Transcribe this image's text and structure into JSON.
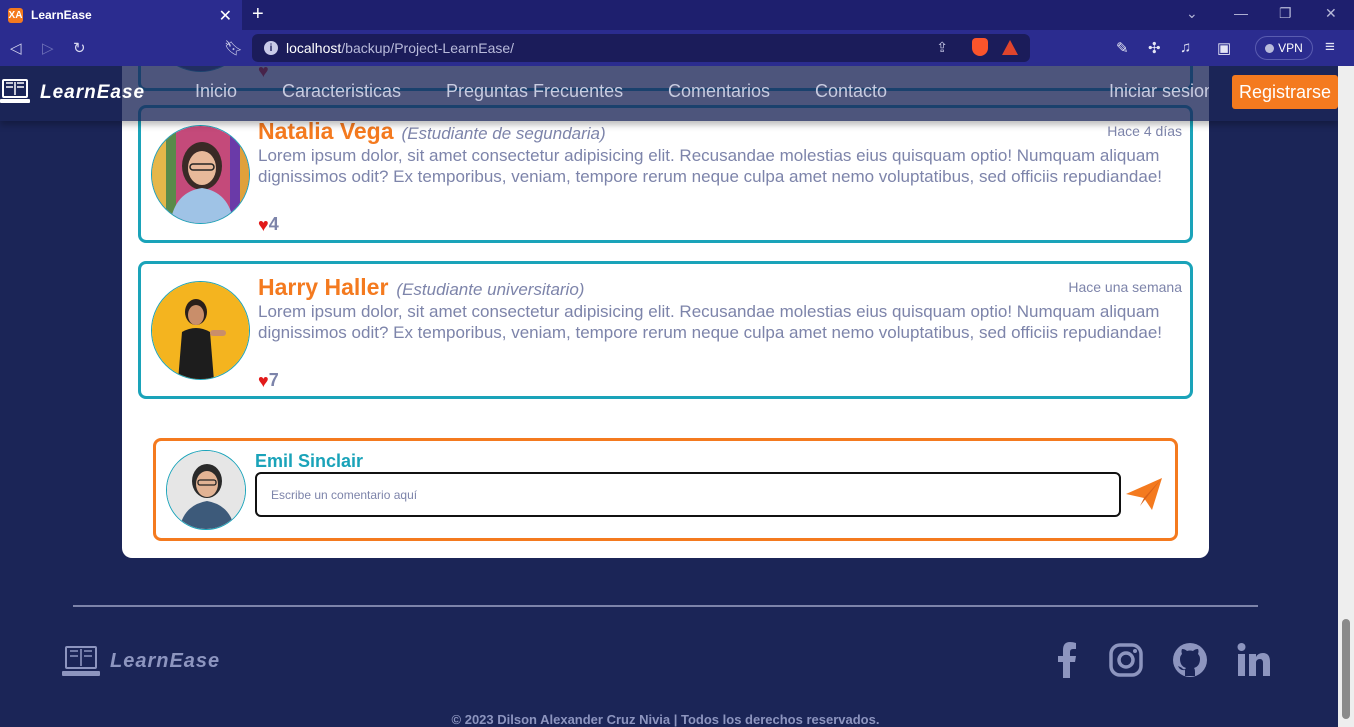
{
  "browser": {
    "tab_title": "LearnEase",
    "tab_favicon": "XA",
    "url_host": "localhost",
    "url_path": "/backup/Project-LearnEase/",
    "vpn_label": "VPN"
  },
  "navbar": {
    "logo": "LearnEase",
    "links": [
      "Inicio",
      "Caracteristicas",
      "Preguntas Frecuentes",
      "Comentarios",
      "Contacto"
    ],
    "login": "Iniciar sesion",
    "register": "Registrarse"
  },
  "comments": [
    {
      "name": "Natalia Vega",
      "role": "(Estudiante de segundaria)",
      "time": "Hace 4 días",
      "text": "Lorem ipsum dolor, sit amet consectetur adipisicing elit. Recusandae molestias eius quisquam optio! Numquam aliquam dignissimos odit? Ex temporibus, veniam, tempore rerum neque culpa amet nemo voluptatibus, sed officiis repudiandae!",
      "likes": "4"
    },
    {
      "name": "Harry Haller",
      "role": "(Estudiante universitario)",
      "time": "Hace una semana",
      "text": "Lorem ipsum dolor, sit amet consectetur adipisicing elit. Recusandae molestias eius quisquam optio! Numquam aliquam dignissimos odit? Ex temporibus, veniam, tempore rerum neque culpa amet nemo voluptatibus, sed officiis repudiandae!",
      "likes": "7"
    }
  ],
  "composer": {
    "name": "Emil Sinclair",
    "placeholder": "Escribe un comentario aquí"
  },
  "footer": {
    "logo": "LearnEase",
    "social": [
      "facebook-icon",
      "instagram-icon",
      "github-icon",
      "linkedin-icon"
    ],
    "copyright": "© 2023 Dilson Alexander Cruz Nivia | Todos los derechos reservados."
  },
  "colors": {
    "accent_orange": "#f47a1f",
    "accent_teal": "#1aa3b9",
    "page_bg": "#1b2557",
    "muted_text": "#7d84aa"
  }
}
